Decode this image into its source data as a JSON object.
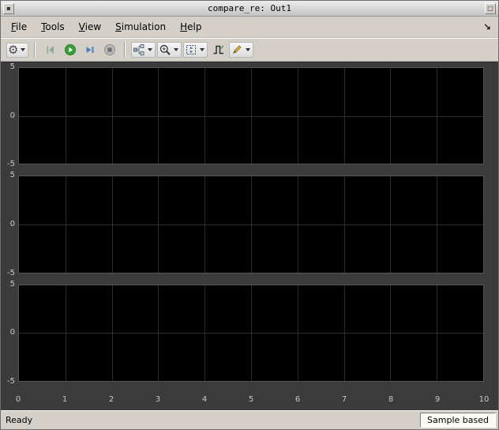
{
  "window": {
    "title": "compare_re: Out1"
  },
  "menu": {
    "items": [
      {
        "id": "file",
        "label": "File"
      },
      {
        "id": "tools",
        "label": "Tools"
      },
      {
        "id": "view",
        "label": "View"
      },
      {
        "id": "simulation",
        "label": "Simulation"
      },
      {
        "id": "help",
        "label": "Help"
      }
    ]
  },
  "toolbar": {
    "buttons": [
      {
        "id": "configuration",
        "icon": "gear-icon",
        "dropdown": true
      },
      {
        "id": "run-backward",
        "icon": "run-backward-icon",
        "dropdown": false
      },
      {
        "id": "run",
        "icon": "run-icon",
        "dropdown": false
      },
      {
        "id": "step-forward",
        "icon": "step-forward-icon",
        "dropdown": false
      },
      {
        "id": "stop",
        "icon": "stop-icon",
        "dropdown": false
      },
      {
        "id": "stepping-options",
        "icon": "stepper-icon",
        "dropdown": true
      },
      {
        "id": "zoom",
        "icon": "zoom-icon",
        "dropdown": true
      },
      {
        "id": "span",
        "icon": "span-icon",
        "dropdown": true
      },
      {
        "id": "measurements",
        "icon": "measurements-icon",
        "dropdown": false
      },
      {
        "id": "style",
        "icon": "pencil-icon",
        "dropdown": true
      }
    ]
  },
  "statusbar": {
    "left": "Ready",
    "right": "Sample based"
  },
  "colors": {
    "chrome": "#d4d0c8",
    "scope_background": "#3b3b3b",
    "plot_background": "#000000",
    "grid_line": "#2d2d2d",
    "tick_label": "#c8c8c8",
    "run_green": "#3a9d3a",
    "step_blue": "#4f81bd"
  },
  "chart_data": [
    {
      "type": "line",
      "title": "",
      "xlim": [
        0,
        10
      ],
      "ylim": [
        -5,
        5
      ],
      "xticks": [
        0,
        1,
        2,
        3,
        4,
        5,
        6,
        7,
        8,
        9,
        10
      ],
      "yticks": [
        5,
        0,
        -5
      ],
      "grid": true,
      "series": [],
      "x_axis_visible": false
    },
    {
      "type": "line",
      "title": "",
      "xlim": [
        0,
        10
      ],
      "ylim": [
        -5,
        5
      ],
      "xticks": [
        0,
        1,
        2,
        3,
        4,
        5,
        6,
        7,
        8,
        9,
        10
      ],
      "yticks": [
        5,
        0,
        -5
      ],
      "grid": true,
      "series": [],
      "x_axis_visible": false
    },
    {
      "type": "line",
      "title": "",
      "xlim": [
        0,
        10
      ],
      "ylim": [
        -5,
        5
      ],
      "xticks": [
        0,
        1,
        2,
        3,
        4,
        5,
        6,
        7,
        8,
        9,
        10
      ],
      "yticks": [
        5,
        0,
        -5
      ],
      "grid": true,
      "series": [],
      "x_axis_visible": true
    }
  ]
}
